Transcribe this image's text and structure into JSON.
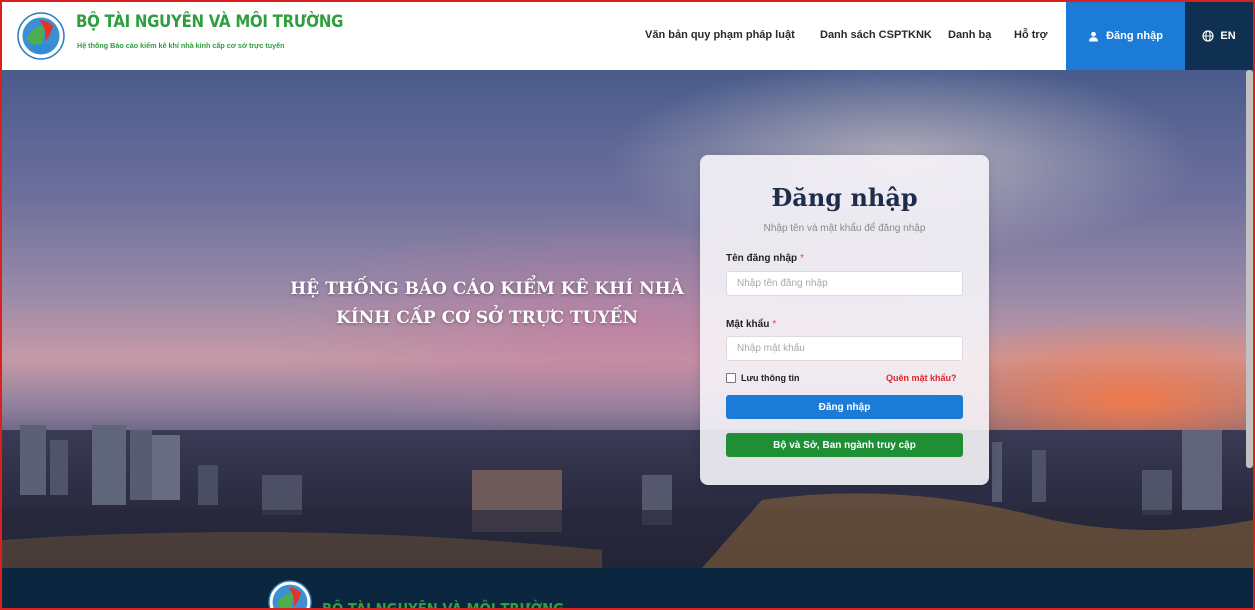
{
  "header": {
    "brand_title": "BỘ TÀI NGUYÊN VÀ MÔI TRƯỜNG",
    "brand_subtitle": "Hệ thống Báo cáo kiểm kê khí nhà kính cấp cơ sở trực tuyến",
    "nav": [
      {
        "label": "Văn bản quy phạm pháp luật"
      },
      {
        "label": "Danh sách CSPTKNK"
      },
      {
        "label": "Danh bạ"
      },
      {
        "label": "Hỗ trợ"
      }
    ],
    "login_label": "Đăng nhập",
    "lang_label": "EN"
  },
  "hero": {
    "title_line1": "HỆ THỐNG BÁO CÁO KIỂM KÊ KHÍ NHÀ",
    "title_line2": "KÍNH CẤP CƠ SỞ TRỰC TUYẾN"
  },
  "login": {
    "title": "Đăng nhập",
    "subtitle": "Nhập tên và mật khẩu để đăng nhập",
    "username_label": "Tên đăng nhập",
    "username_placeholder": "Nhập tên đăng nhập",
    "password_label": "Mật khẩu",
    "password_placeholder": "Nhập mật khẩu",
    "required_mark": "*",
    "remember_label": "Lưu thông tin",
    "forgot_label": "Quên mật khẩu?",
    "submit_label": "Đăng nhập",
    "access_label": "Bộ và Sở, Ban ngành truy cập"
  },
  "footer": {
    "brand_title": "BỘ TÀI NGUYÊN VÀ MÔI TRƯỜNG"
  },
  "colors": {
    "primary": "#1d7bd8",
    "brand_green": "#2e9e3e",
    "access_green": "#1f8f36",
    "forgot_red": "#e0242c",
    "footer_bg": "#0b2740",
    "lang_bg": "#0f3050"
  }
}
